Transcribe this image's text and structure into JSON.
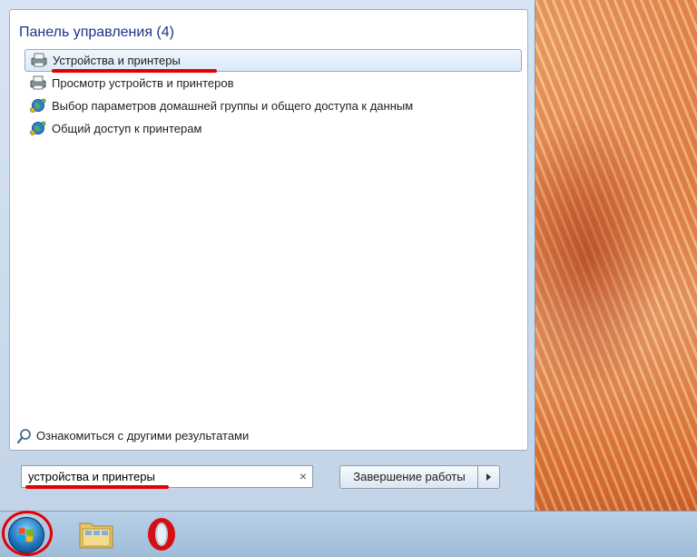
{
  "start_menu": {
    "results_title": "Панель управления (4)",
    "results": [
      {
        "label": "Устройства и принтеры",
        "icon": "devices-printers-icon",
        "selected": true
      },
      {
        "label": "Просмотр устройств и принтеров",
        "icon": "devices-printers-icon",
        "selected": false
      },
      {
        "label": "Выбор параметров домашней группы и общего доступа к данным",
        "icon": "network-globe-icon",
        "selected": false
      },
      {
        "label": "Общий доступ к принтерам",
        "icon": "network-globe-icon",
        "selected": false
      }
    ],
    "more_results": "Ознакомиться с другими результатами",
    "search": {
      "value": "устройства и принтеры",
      "clear_glyph": "×"
    },
    "shutdown_label": "Завершение работы"
  },
  "taskbar": {
    "items": [
      "start-orb",
      "windows-explorer-icon",
      "opera-icon"
    ]
  },
  "colors": {
    "highlight_annotation": "#e30000",
    "title_blue": "#1e3287"
  }
}
